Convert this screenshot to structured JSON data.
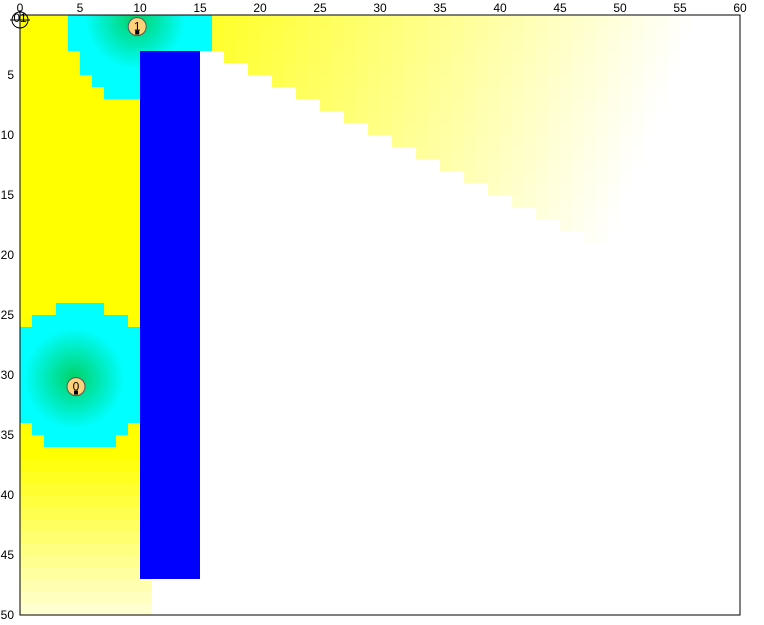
{
  "grid": {
    "cols": 60,
    "rows": 50
  },
  "axes": {
    "x_ticks": [
      "0",
      "5",
      "10",
      "15",
      "20",
      "25",
      "30",
      "35",
      "40",
      "45",
      "50",
      "55",
      "60"
    ],
    "y_ticks": [
      "5",
      "10",
      "15",
      "20",
      "25",
      "30",
      "35",
      "40",
      "45",
      "50"
    ]
  },
  "colors": {
    "frame": "#000000",
    "background": "#ffffff",
    "obstacle": "#0000ff",
    "signal_strong": "#ffff00",
    "signal_weak": "#ffffff",
    "coverage_ring": "#00ffff",
    "coverage_center": "#00cc55",
    "robot_fill": "#ffd27a",
    "robot_stroke": "#555555"
  },
  "obstacle": {
    "col_start": 10,
    "col_end": 15,
    "row_start": 3,
    "row_end": 47
  },
  "robots": [
    {
      "id": "0",
      "x": 4.5,
      "y": 30.3
    },
    {
      "id": "1",
      "x": 9.6,
      "y": 0.3
    }
  ],
  "origin_marker": {
    "label": "01",
    "icon": "crosshair-icon"
  }
}
